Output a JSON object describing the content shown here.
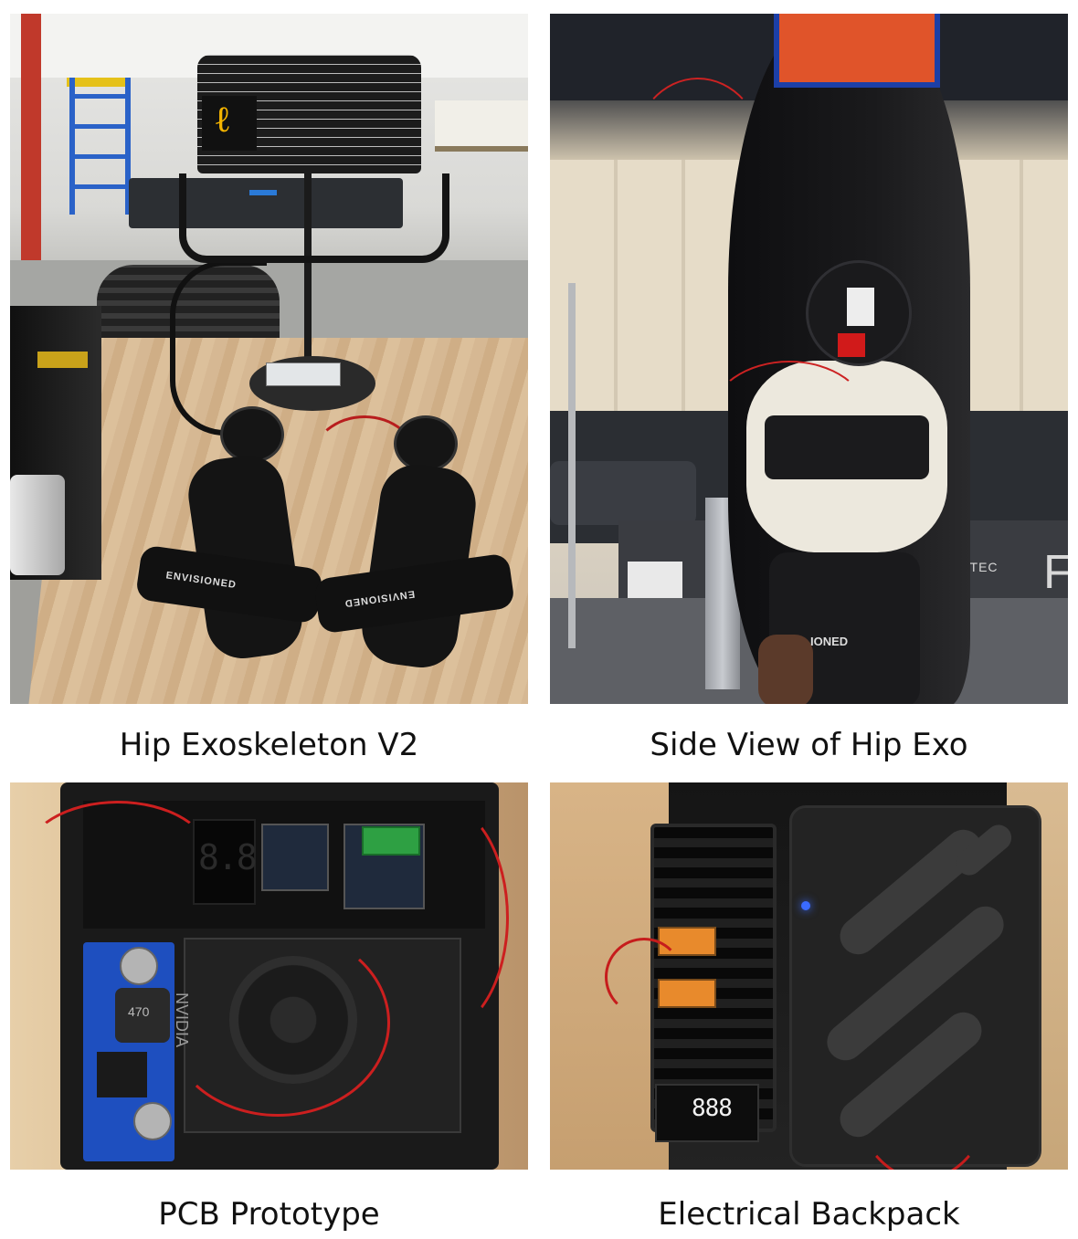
{
  "figure": {
    "panels": [
      {
        "caption": "Hip Exoskeleton V2",
        "logo_text": "ℓ",
        "brand_text": "ENVISIONED"
      },
      {
        "caption": "Side View of Hip Exo",
        "brand_text": "BERTEC",
        "brand_letter": "F",
        "band_text": "IONED"
      },
      {
        "caption": "PCB Prototype",
        "display_text": "8.8.8.",
        "inductor_text": "470",
        "chip_text": "NVIDIA"
      },
      {
        "caption": "Electrical Backpack",
        "display_text": "888"
      }
    ]
  }
}
